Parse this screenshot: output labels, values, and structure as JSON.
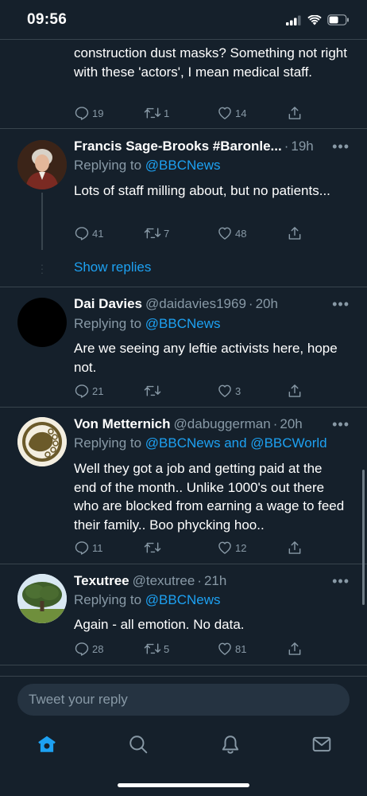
{
  "status": {
    "time": "09:56"
  },
  "top_tweet": {
    "text": "construction dust masks? Something not right with these 'actors', I mean medical staff.",
    "replies": "19",
    "retweets": "1",
    "likes": "14"
  },
  "tweets": [
    {
      "name": "Francis Sage-Brooks #Baronle...",
      "handle": "",
      "time": "19h",
      "replying_prefix": "Replying to ",
      "replying_to": "@BBCNews",
      "text": "Lots of staff milling about, but no patients...",
      "replies": "41",
      "retweets": "7",
      "likes": "48",
      "show_replies": "Show replies"
    },
    {
      "name": "Dai Davies",
      "handle": "@daidavies1969",
      "time": "20h",
      "replying_prefix": "Replying to ",
      "replying_to": "@BBCNews",
      "text": "Are we seeing any leftie activists here, hope not.",
      "replies": "21",
      "retweets": "",
      "likes": "3"
    },
    {
      "name": "Von Metternich",
      "handle": "@dabuggerman",
      "time": "20h",
      "replying_prefix": "Replying to ",
      "replying_to": "@BBCNews and @BBCWorld",
      "text": "Well they got a job and getting paid at the end of the month.. Unlike 1000's out there who are blocked from earning a wage to feed their family.. Boo phycking hoo..",
      "replies": "11",
      "retweets": "",
      "likes": "12"
    },
    {
      "name": "Texutree",
      "handle": "@texutree",
      "time": "21h",
      "replying_prefix": "Replying to ",
      "replying_to": "@BBCNews",
      "text": "Again - all emotion. No data.",
      "replies": "28",
      "retweets": "5",
      "likes": "81"
    }
  ],
  "composer": {
    "placeholder": "Tweet your reply"
  },
  "icons": {
    "reply": "reply-icon",
    "retweet": "retweet-icon",
    "like": "heart-icon",
    "share": "share-icon",
    "more": "more-icon",
    "home": "home-icon",
    "search": "search-icon",
    "notifications": "bell-icon",
    "messages": "mail-icon"
  },
  "colors": {
    "background": "#15202b",
    "accent": "#1da1f2",
    "muted": "#8899a6",
    "divider": "#38444d"
  }
}
